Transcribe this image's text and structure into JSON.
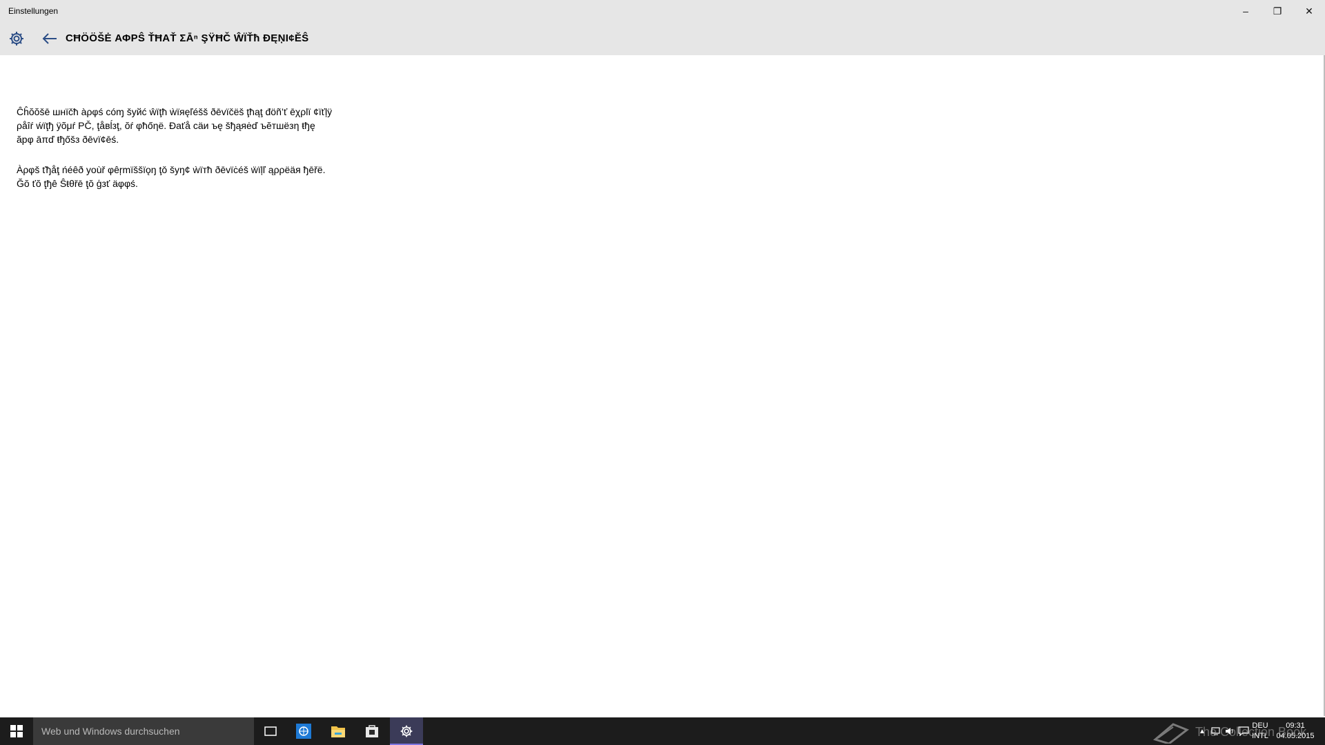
{
  "window": {
    "app_title": "Einstellungen",
    "controls": {
      "minimize": "–",
      "restore": "❐",
      "close": "✕"
    }
  },
  "header": {
    "page_title": "CĦÖÖŠĖ ΑΦΡŜ ŤĦΑŤ ΣĀⁿ ŞŸĦČ ŴÏŤħ ĐĘŅI¢ĔŜ",
    "icons": {
      "settings": "gear-icon",
      "back": "back-arrow-icon"
    }
  },
  "content": {
    "paragraph_1": "Ĉĥŏŏšē шнïčħ àρφś cóɱ šуйć ŵïţħ ẁïяęľéšš ðēvïčëš ţħąţ đöñ’ť ēχρlï ¢ïťļÿ ρåîŕ ẃïţђ ÿõμŕ PČ, ţåвĺзţ, ŏŕ φħőηë. Ðаťå сäи ъę šђąяėď ъĕтшёзη ŧђę ăрφ āπď ŧђőšз ðēvï¢ēś.",
    "paragraph_2": "Àρφš ťђåţ ńéêð yοùř φêŗmïššïǫŋ ţǒ šуŋ¢ ẁïтћ ðēvïċéš ẅïļľ ąρρёäя ђēřё. Ğŏ ťŏ ţђê Ŝŧθřē ţŏ ģзť äφφś."
  },
  "taskbar": {
    "search_placeholder": "Web und Windows durchsuchen",
    "pinned": [
      "task-view-icon",
      "edge-icon",
      "file-explorer-icon",
      "store-icon",
      "settings-icon"
    ],
    "active_app": "settings",
    "watermark": "The Collection Book",
    "language": {
      "line1": "DEU",
      "line2": "INTL"
    },
    "clock": {
      "time": "09:31",
      "date": "04.05.2015"
    },
    "colors": {
      "taskbar": "#1c1c1c",
      "active": "#7d75e0"
    }
  }
}
